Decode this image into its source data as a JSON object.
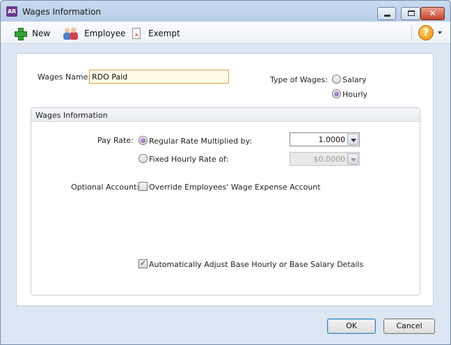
{
  "window": {
    "title": "Wages Information",
    "app_badge": "AR"
  },
  "toolbar": {
    "new_label": "New",
    "employee_label": "Employee",
    "exempt_label": "Exempt",
    "help_glyph": "?"
  },
  "form": {
    "wages_name_label": "Wages Name:",
    "wages_name_value": "RDO Paid",
    "type_label": "Type of Wages:",
    "type_options": [
      {
        "label": "Salary",
        "selected": false
      },
      {
        "label": "Hourly",
        "selected": true
      }
    ]
  },
  "group": {
    "title": "Wages Information",
    "pay_rate_label": "Pay Rate:",
    "regular_rate_label": "Regular Rate Multiplied by:",
    "regular_rate_value": "1.0000",
    "fixed_rate_label": "Fixed Hourly Rate of:",
    "fixed_rate_value": "$0.0000",
    "optional_account_label": "Optional Account:",
    "override_label": "Override Employees' Wage Expense Account",
    "auto_adjust_label": "Automatically Adjust Base Hourly or Base Salary Details"
  },
  "footer": {
    "ok_label": "OK",
    "cancel_label": "Cancel"
  }
}
